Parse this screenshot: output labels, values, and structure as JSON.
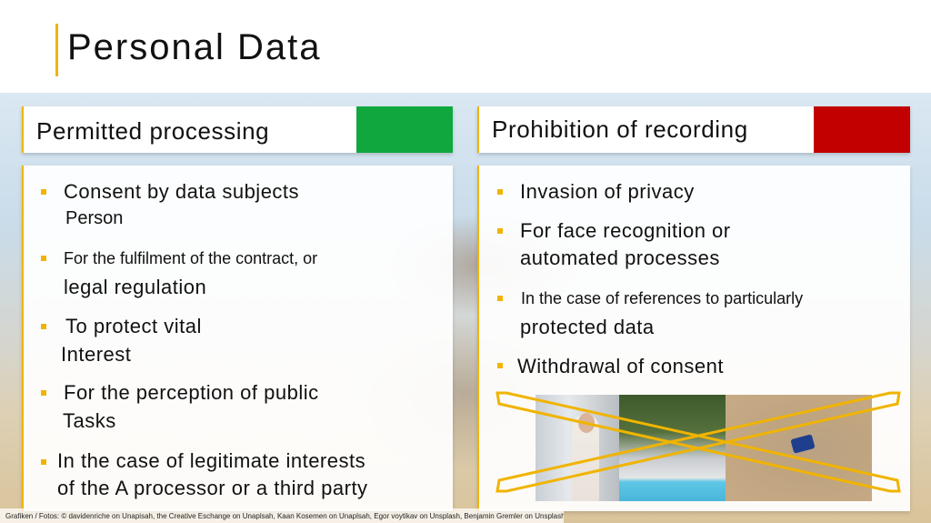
{
  "slide": {
    "title": "Personal Data"
  },
  "left": {
    "header": "Permitted processing",
    "accent_color": "#10a83e",
    "items": [
      {
        "line1": "Consent by data subjects",
        "line2": "Person"
      },
      {
        "line1": "For the fulfilment of the contract, or",
        "line2": "legal regulation"
      },
      {
        "line1": "To protect vital",
        "line2": "Interest"
      },
      {
        "line1": "For the perception of public",
        "line2": "Tasks"
      },
      {
        "line1": "In the case of legitimate interests",
        "line2": "of the A processor or a third party"
      }
    ]
  },
  "right": {
    "header": "Prohibition of recording",
    "accent_color": "#c30000",
    "items": [
      {
        "line1": "Invasion of privacy"
      },
      {
        "line1": "For face recognition or",
        "line2": "automated processes"
      },
      {
        "line1": "In the case of references to particularly",
        "line2": "protected data"
      },
      {
        "line1": "Withdrawal of consent"
      }
    ]
  },
  "credit": "Grafiken / Fotos: © davidenriche on Unapisah, the Creative Eschange on Unaplsah, Kaan Kosemen on Unaplsah, Egor voytikav on Unsplash, Benjamin Gremler on Unsplash",
  "colors": {
    "accent": "#f0b400"
  }
}
